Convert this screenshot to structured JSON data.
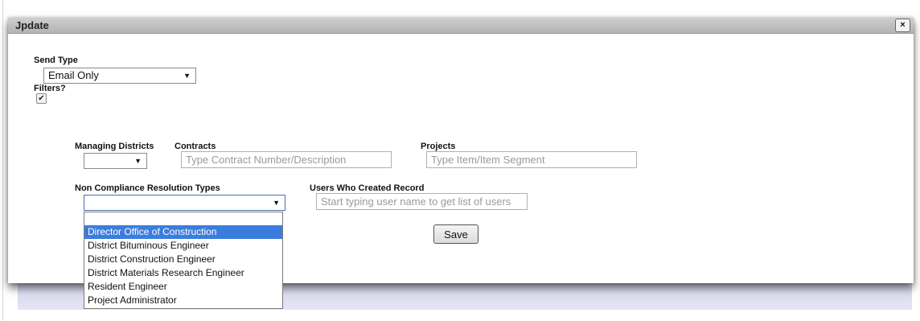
{
  "dialog": {
    "title": "Jpdate",
    "close_label": "×"
  },
  "send_type": {
    "label": "Send Type",
    "value": "Email Only",
    "arrow": "▼"
  },
  "filters": {
    "label": "Filters?",
    "checked": true,
    "check_glyph": "✔"
  },
  "managing_districts": {
    "label": "Managing Districts",
    "value": "",
    "arrow": "▼"
  },
  "contracts": {
    "label": "Contracts",
    "placeholder": "Type Contract Number/Description"
  },
  "projects": {
    "label": "Projects",
    "placeholder": "Type Item/Item Segment"
  },
  "non_compliance": {
    "label": "Non Compliance Resolution Types",
    "value": "",
    "arrow": "▼",
    "options": [
      "",
      "Director Office of Construction",
      "District Bituminous Engineer",
      "District Construction Engineer",
      "District Materials Research Engineer",
      "Resident Engineer",
      "Project Administrator"
    ],
    "highlighted": "Director Office of Construction"
  },
  "users_created": {
    "label": "Users Who Created Record",
    "placeholder": "Start typing user name to get list of users"
  },
  "save_label": "Save",
  "colors": {
    "highlight": "#3b7ddd",
    "titlebar": "#bdbdbd",
    "band": "#dcdcf0"
  }
}
